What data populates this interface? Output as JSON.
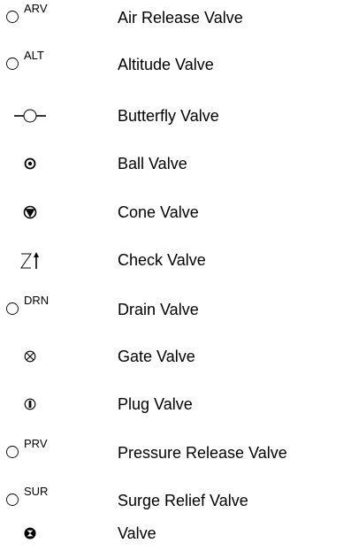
{
  "legend": {
    "items": [
      {
        "symbol": "circle-abbr",
        "abbr": "ARV",
        "label": "Air Release Valve"
      },
      {
        "symbol": "circle-abbr",
        "abbr": "ALT",
        "label": "Altitude Valve"
      },
      {
        "symbol": "butterfly",
        "label": "Butterfly Valve"
      },
      {
        "symbol": "ball",
        "label": "Ball Valve"
      },
      {
        "symbol": "cone",
        "label": "Cone Valve"
      },
      {
        "symbol": "check",
        "label": "Check Valve"
      },
      {
        "symbol": "circle-abbr",
        "abbr": "DRN",
        "label": "Drain Valve"
      },
      {
        "symbol": "gate",
        "label": "Gate Valve"
      },
      {
        "symbol": "plug",
        "label": "Plug Valve"
      },
      {
        "symbol": "circle-abbr",
        "abbr": "PRV",
        "label": "Pressure Release Valve"
      },
      {
        "symbol": "circle-abbr",
        "abbr": "SUR",
        "label": "Surge Relief Valve"
      },
      {
        "symbol": "valve",
        "label": "Valve"
      }
    ]
  }
}
